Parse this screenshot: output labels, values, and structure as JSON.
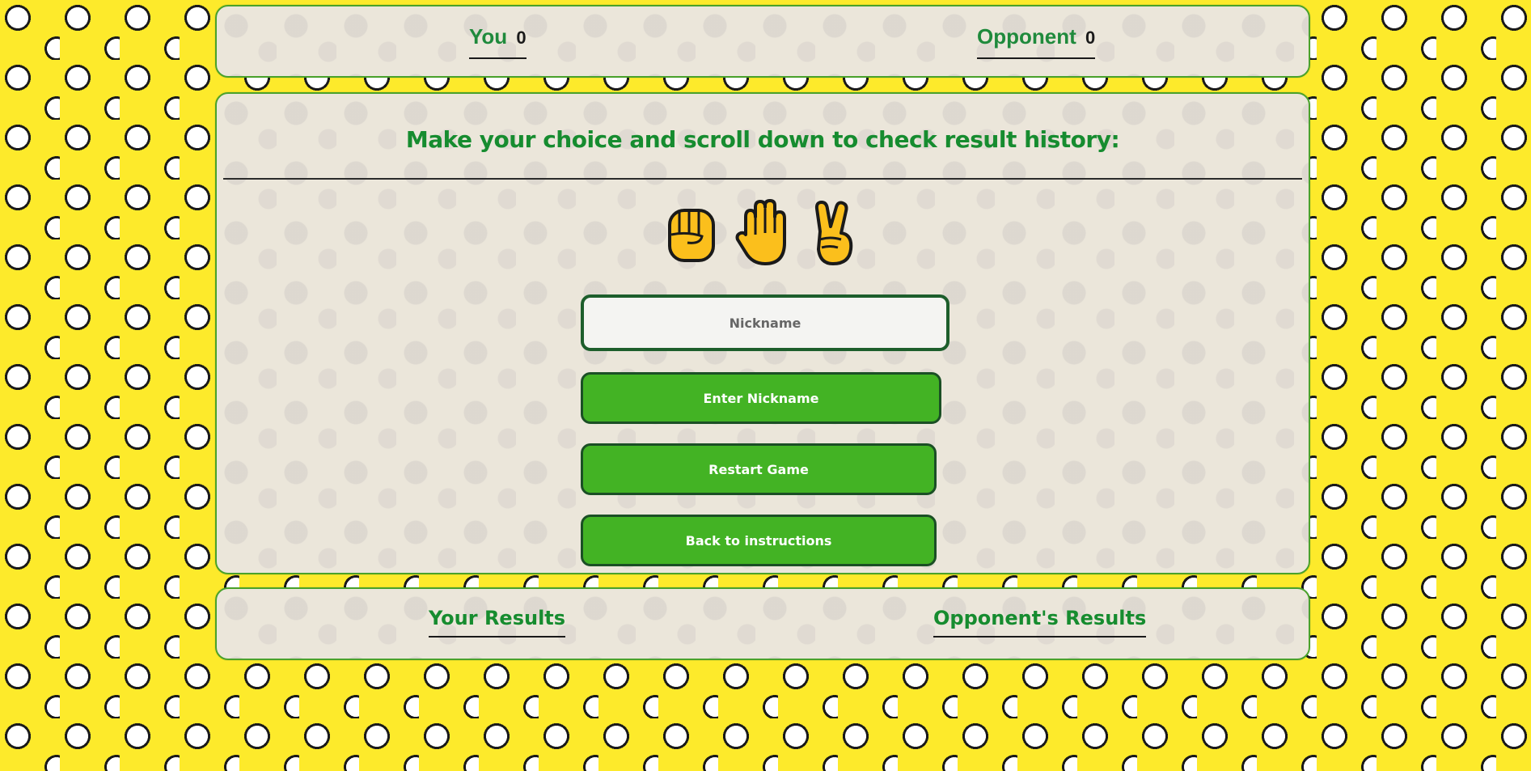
{
  "score": {
    "you_label": "You",
    "you_value": "0",
    "opponent_label": "Opponent",
    "opponent_value": "0"
  },
  "main": {
    "headline": "Make your choice and scroll down to check result history:",
    "choices": [
      {
        "name": "rock",
        "icon": "rock-fist-icon"
      },
      {
        "name": "paper",
        "icon": "paper-hand-icon"
      },
      {
        "name": "scissors",
        "icon": "scissors-hand-icon"
      }
    ],
    "nickname_placeholder": "Nickname",
    "enter_button": "Enter Nickname",
    "restart_button": "Restart Game",
    "back_button": "Back to instructions"
  },
  "results": {
    "your_label": "Your Results",
    "opponent_label": "Opponent's Results"
  },
  "colors": {
    "background": "#fdea2b",
    "panel": "#ebe6da",
    "accent_green": "#168c2f",
    "button_green": "#43b324"
  }
}
